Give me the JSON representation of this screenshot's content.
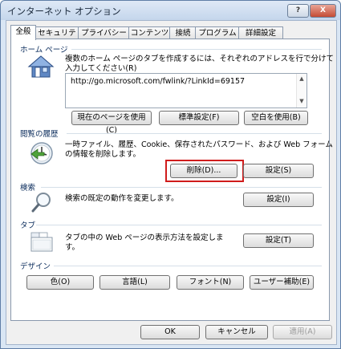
{
  "window": {
    "title": "インターネット オプション",
    "help_label": "?",
    "close_label": "X"
  },
  "tabs": [
    {
      "label": "全般"
    },
    {
      "label": "セキュリティ"
    },
    {
      "label": "プライバシー"
    },
    {
      "label": "コンテンツ"
    },
    {
      "label": "接続"
    },
    {
      "label": "プログラム"
    },
    {
      "label": "詳細設定"
    }
  ],
  "home": {
    "section_label": "ホーム ページ",
    "desc_line1": "複数のホーム ページのタブを作成するには、それぞれのアドレスを行で分けて",
    "desc_line2": "入力してください(R)",
    "url": "http://go.microsoft.com/fwlink/?LinkId=69157",
    "btn_current": "現在のページを使用(C)",
    "btn_default": "標準設定(F)",
    "btn_blank": "空白を使用(B)"
  },
  "history": {
    "section_label": "閲覧の履歴",
    "desc_line1": "一時ファイル、履歴、Cookie、保存されたパスワード、および Web フォーム",
    "desc_line2": "の情報を削除します。",
    "btn_delete": "削除(D)...",
    "btn_settings": "設定(S)"
  },
  "search": {
    "section_label": "検索",
    "desc": "検索の既定の動作を変更します。",
    "btn_settings": "設定(I)"
  },
  "tabs_section": {
    "section_label": "タブ",
    "desc_line1": "タブの中の Web ページの表示方法を設定しま",
    "desc_line2": "す。",
    "btn_settings": "設定(T)"
  },
  "design": {
    "section_label": "デザイン",
    "btn_colors": "色(O)",
    "btn_languages": "言語(L)",
    "btn_fonts": "フォント(N)",
    "btn_accessibility": "ユーザー補助(E)"
  },
  "footer": {
    "ok": "OK",
    "cancel": "キャンセル",
    "apply": "適用(A)"
  },
  "colors": {
    "highlight": "#d01c1c"
  }
}
